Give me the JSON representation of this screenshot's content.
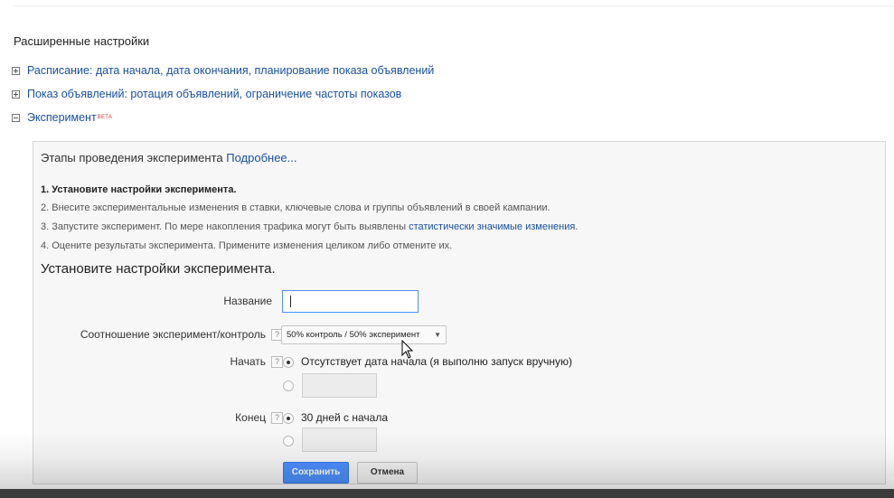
{
  "advanced": {
    "heading": "Расширенные настройки",
    "rows": [
      {
        "label": "Расписание: дата начала, дата окончания, планирование показа объявлений"
      },
      {
        "label": "Показ объявлений: ротация объявлений, ограничение частоты показов"
      },
      {
        "label": "Эксперимент",
        "badge": "BETA"
      }
    ]
  },
  "experiment": {
    "title": "Этапы проведения эксперимента",
    "more_link": "Подробнее...",
    "steps": [
      "1. Установите настройки эксперимента.",
      "2. Внесите экспериментальные изменения в ставки, ключевые слова и группы объявлений в своей кампании.",
      "3. Запустите эксперимент. По мере накопления трафика могут быть выявлены ",
      "4. Оцените результаты эксперимента. Примените изменения целиком либо отмените их."
    ],
    "step3_link": "статистически значимые изменения",
    "step3_tail": ".",
    "form_title": "Установите настройки эксперимента.",
    "help_glyph": "?",
    "name": {
      "label": "Название",
      "value": ""
    },
    "ratio": {
      "label": "Соотношение эксперимент/контроль",
      "selected": "50% контроль / 50% эксперимент"
    },
    "start": {
      "label": "Начать",
      "option1": "Отсутствует дата начала (я выполню запуск вручную)"
    },
    "end": {
      "label": "Конец",
      "option1": "30 дней с начала"
    },
    "save_label": "Сохранить",
    "cancel_label": "Отмена"
  },
  "colors": {
    "link": "#1a4fa0",
    "primary": "#4d90fe",
    "beta": "#d23b2b"
  }
}
